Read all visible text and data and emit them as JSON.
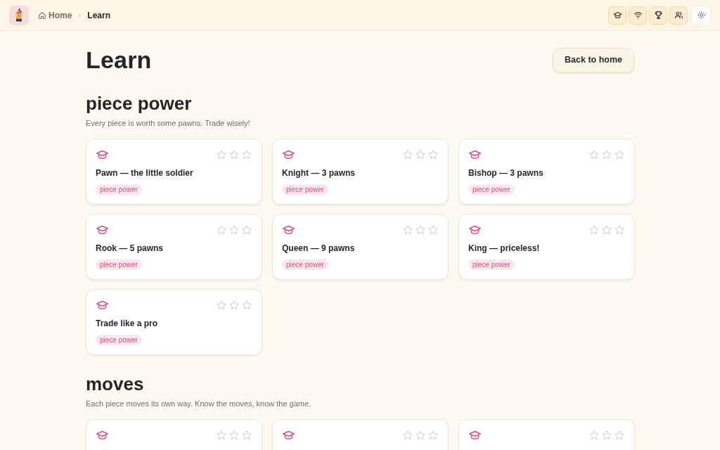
{
  "header": {
    "breadcrumb": [
      {
        "label": "Home",
        "kind": "link"
      },
      {
        "label": "Learn",
        "kind": "current"
      }
    ]
  },
  "page": {
    "title": "Learn",
    "back_button": "Back to home"
  },
  "sections": [
    {
      "heading": "piece power",
      "description": "Every piece is worth some pawns. Trade wisely!",
      "lessons": [
        {
          "title": "Pawn — the little soldier",
          "tag": "piece power",
          "stars": 0
        },
        {
          "title": "Knight — 3 pawns",
          "tag": "piece power",
          "stars": 0
        },
        {
          "title": "Bishop — 3 pawns",
          "tag": "piece power",
          "stars": 0
        },
        {
          "title": "Rook — 5 pawns",
          "tag": "piece power",
          "stars": 0
        },
        {
          "title": "Queen — 9 pawns",
          "tag": "piece power",
          "stars": 0
        },
        {
          "title": "King — priceless!",
          "tag": "piece power",
          "stars": 0
        },
        {
          "title": "Trade like a pro",
          "tag": "piece power",
          "stars": 0
        }
      ]
    },
    {
      "heading": "moves",
      "description": "Each piece moves its own way. Know the moves, know the game.",
      "lessons": [
        {
          "stars": 0
        },
        {
          "stars": 0
        },
        {
          "stars": 0
        }
      ]
    }
  ]
}
